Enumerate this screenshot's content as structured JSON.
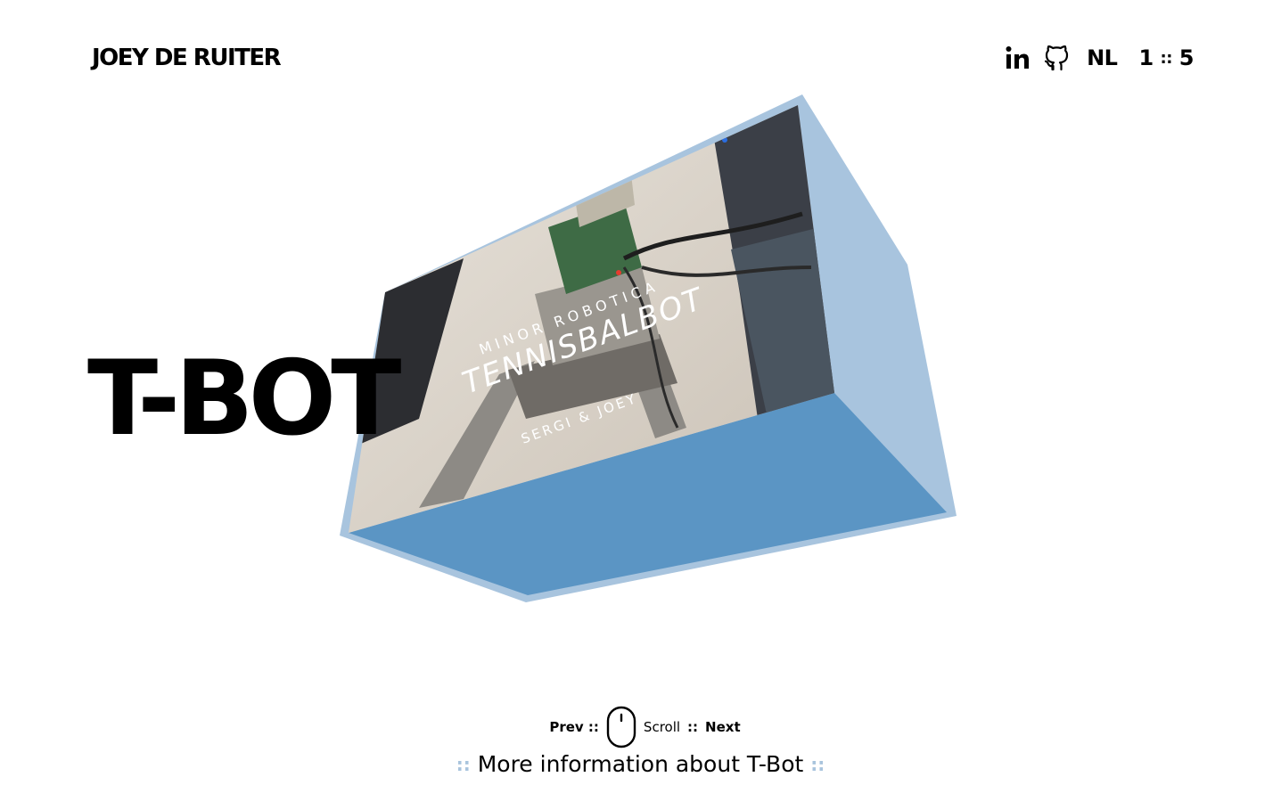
{
  "header": {
    "brand": "JOEY DE RUITER",
    "icons": [
      "linkedin-icon",
      "github-icon"
    ],
    "language": "NL",
    "counter_current": "1",
    "counter_sep": "::",
    "counter_total": "5"
  },
  "project": {
    "title": "T-BOT",
    "thumbnail": {
      "line1": "MINOR ROBOTICA",
      "line2": "TENNISBALBOT",
      "line3": "SERGI & JOEY"
    }
  },
  "footer": {
    "prev_label": "Prev ::",
    "scroll_label": "Scroll",
    "next_sep": "::",
    "next_label": "Next",
    "dots": "::",
    "more_info": "More information about T-Bot"
  },
  "colors": {
    "box_light": "#a8c4de",
    "box_dark": "#5b95c4",
    "text": "#000000",
    "dots": "#a9c4dd"
  }
}
